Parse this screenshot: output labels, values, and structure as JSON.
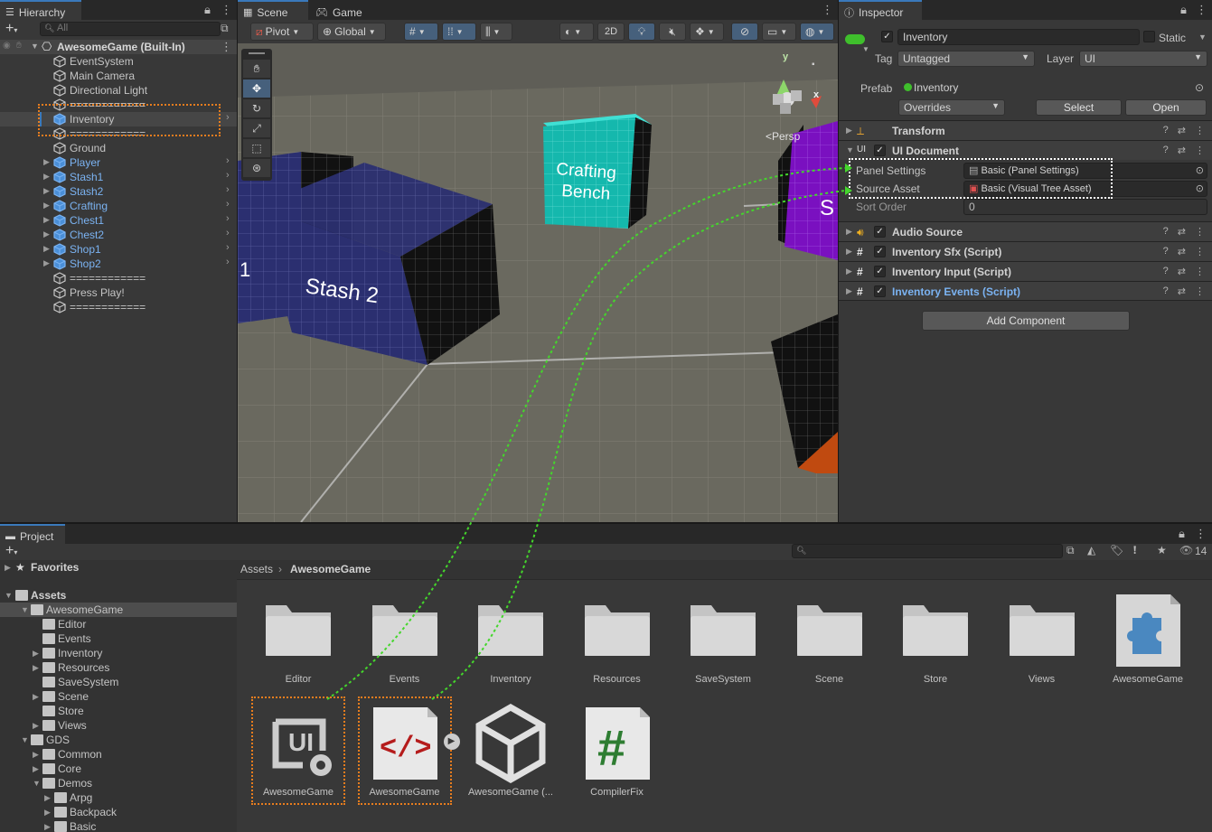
{
  "hierarchy": {
    "tab_label": "Hierarchy",
    "search_placeholder": "All",
    "scene_name": "AwesomeGame (Built-In)",
    "items": [
      {
        "label": "EventSystem"
      },
      {
        "label": "Main Camera"
      },
      {
        "label": "Directional Light"
      },
      {
        "label": "============"
      },
      {
        "label": "Inventory"
      },
      {
        "label": "============"
      },
      {
        "label": "Ground"
      },
      {
        "label": "Player"
      },
      {
        "label": "Stash1"
      },
      {
        "label": "Stash2"
      },
      {
        "label": "Crafting"
      },
      {
        "label": "Chest1"
      },
      {
        "label": "Chest2"
      },
      {
        "label": "Shop1"
      },
      {
        "label": "Shop2"
      },
      {
        "label": "============"
      },
      {
        "label": "Press Play!"
      },
      {
        "label": "============"
      }
    ]
  },
  "scene": {
    "tab_scene": "Scene",
    "tab_game": "Game",
    "pivot": "Pivot",
    "global": "Global",
    "mode_2d": "2D",
    "persp": "<Persp",
    "axis_y": "y",
    "axis_x": "x",
    "cube_crafting": "Crafting\nBench",
    "cube_stash": "Stash 2",
    "cube_partial_left": "1",
    "cube_partial_right": "S"
  },
  "inspector": {
    "tab_label": "Inspector",
    "object_name": "Inventory",
    "static_label": "Static",
    "tag_label": "Tag",
    "tag_value": "Untagged",
    "layer_label": "Layer",
    "layer_value": "UI",
    "prefab_label": "Prefab",
    "prefab_value": "Inventory",
    "overrides": "Overrides",
    "select": "Select",
    "open": "Open",
    "components": [
      {
        "title": "Transform"
      },
      {
        "title": "UI Document"
      },
      {
        "title": "Audio Source"
      },
      {
        "title": "Inventory Sfx (Script)"
      },
      {
        "title": "Inventory Input (Script)"
      },
      {
        "title": "Inventory Events (Script)"
      }
    ],
    "panel_settings_label": "Panel Settings",
    "panel_settings_value": "Basic (Panel Settings)",
    "source_asset_label": "Source Asset",
    "source_asset_value": "Basic (Visual Tree Asset)",
    "sort_order_label": "Sort Order",
    "sort_order_value": "0",
    "add_component": "Add Component"
  },
  "project": {
    "tab_label": "Project",
    "hidden_count": "14",
    "favorites": "Favorites",
    "assets": "Assets",
    "breadcrumb_root": "Assets",
    "breadcrumb_current": "AwesomeGame",
    "tree": [
      {
        "label": "AwesomeGame"
      },
      {
        "label": "Editor"
      },
      {
        "label": "Events"
      },
      {
        "label": "Inventory"
      },
      {
        "label": "Resources"
      },
      {
        "label": "SaveSystem"
      },
      {
        "label": "Scene"
      },
      {
        "label": "Store"
      },
      {
        "label": "Views"
      },
      {
        "label": "GDS"
      },
      {
        "label": "Common"
      },
      {
        "label": "Core"
      },
      {
        "label": "Demos"
      },
      {
        "label": "Arpg"
      },
      {
        "label": "Backpack"
      },
      {
        "label": "Basic"
      }
    ],
    "grid": [
      {
        "label": "Editor"
      },
      {
        "label": "Events"
      },
      {
        "label": "Inventory"
      },
      {
        "label": "Resources"
      },
      {
        "label": "SaveSystem"
      },
      {
        "label": "Scene"
      },
      {
        "label": "Store"
      },
      {
        "label": "Views"
      },
      {
        "label": "AwesomeGame"
      },
      {
        "label": "AwesomeGame"
      },
      {
        "label": "AwesomeGame"
      },
      {
        "label": "AwesomeGame (..."
      },
      {
        "label": "CompilerFix"
      }
    ]
  },
  "colors": {
    "accent": "#3a79bb",
    "selection": "#2c5d87",
    "highlight_orange": "#e87d1e",
    "link_green": "#44d62c",
    "prefab_blue": "#7bb3f2"
  }
}
